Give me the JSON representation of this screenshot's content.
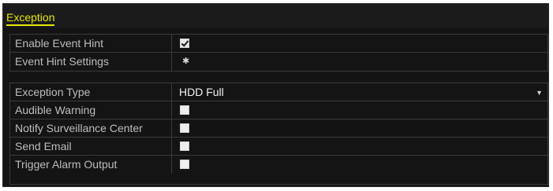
{
  "title": "Exception",
  "group1": {
    "rows": [
      {
        "label": "Enable Event Hint",
        "checked": true
      },
      {
        "label": "Event Hint Settings",
        "icon": "gear-icon"
      }
    ]
  },
  "group2": {
    "exception_type": {
      "label": "Exception Type",
      "value": "HDD Full"
    },
    "rows": [
      {
        "label": "Audible Warning",
        "checked": false
      },
      {
        "label": "Notify Surveillance Center",
        "checked": false
      },
      {
        "label": "Send Email",
        "checked": false
      },
      {
        "label": "Trigger Alarm Output",
        "checked": false
      }
    ]
  },
  "colors": {
    "accent": "#e8e800",
    "background": "#141414",
    "text": "#bdbdbd"
  }
}
